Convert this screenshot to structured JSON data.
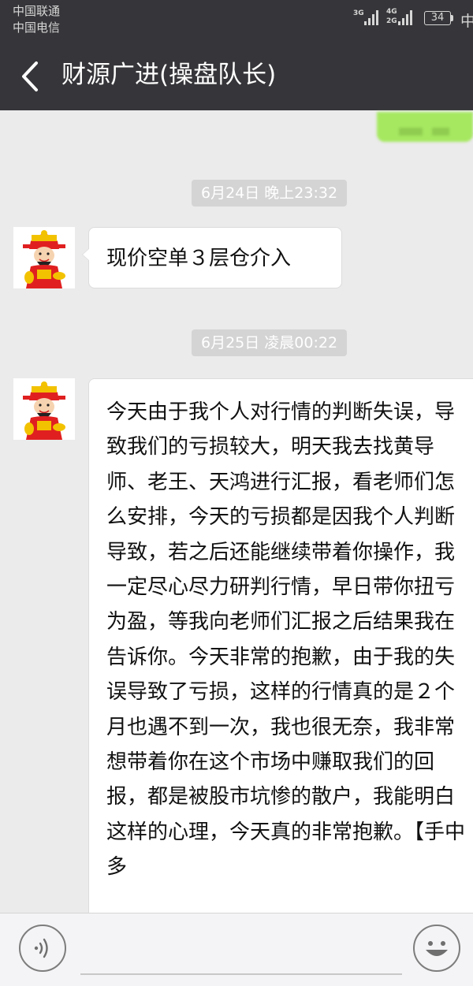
{
  "status_bar": {
    "carrier_1": "中国联通",
    "carrier_2": "中国电信",
    "net_1_top": "3G",
    "net_2_top": "4G",
    "net_2_bottom": "2G",
    "battery": "34",
    "cut_off_text": "中",
    "icons": [
      "signal-bars-icon",
      "signal-bars-icon",
      "battery-icon"
    ]
  },
  "header": {
    "back_icon": "chevron-left-icon",
    "title": "财源广进(操盘队长)"
  },
  "messages": [
    {
      "timestamp": "6月24日 晚上23:32",
      "text": "现价空单３层仓介入"
    },
    {
      "timestamp": "6月25日 凌晨00:22",
      "text": "今天由于我个人对行情的判断失误，导致我们的亏损较大，明天我去找黄导师、老王、天鸿进行汇报，看老师们怎么安排，今天的亏损都是因我个人判断导致，若之后还能继续带着你操作，我一定尽心尽力研判行情，早日带你扭亏为盈，等我向老师们汇报之后结果我在告诉你。今天非常的抱歉，由于我的失误导致了亏损，这样的行情真的是２个月也遇不到一次，我也很无奈，我非常想带着你在这个市场中赚取我们的回报，都是被股市坑惨的散户，我能明白这样的心理，今天真的非常抱歉。【手中多"
    }
  ],
  "input_bar": {
    "voice_icon": "voice-input-icon",
    "emoji_icon": "emoji-icon"
  },
  "colors": {
    "header_bg": "#36363a",
    "chat_bg": "#ebebeb",
    "timestamp_bg": "#d4d4d4",
    "own_bubble": "#a6e860"
  }
}
